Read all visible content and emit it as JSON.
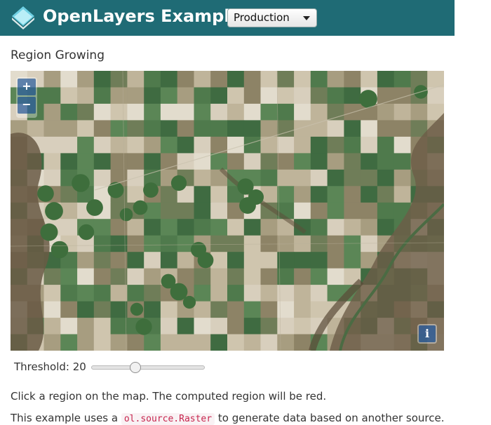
{
  "header": {
    "brand": "OpenLayers Examples",
    "logo_icon": "openlayers-logo-icon",
    "version_select": {
      "selected": "Production"
    },
    "colors": {
      "bar": "#1f6b75",
      "text": "#ffffff"
    }
  },
  "page": {
    "title": "Region Growing"
  },
  "map": {
    "zoom_in_label": "+",
    "zoom_out_label": "−",
    "attribution_label": "i",
    "imagery": "satellite farmland"
  },
  "controls": {
    "threshold_label": "Threshold:",
    "threshold_value": "20",
    "threshold_slider": {
      "min": 1,
      "max": 50,
      "value": 20
    }
  },
  "description": {
    "line1": "Click a region on the map. The computed region will be red.",
    "line2_prefix": "This example uses a",
    "line2_code": "ol.source.Raster",
    "line2_suffix": "to generate data based on another source."
  }
}
